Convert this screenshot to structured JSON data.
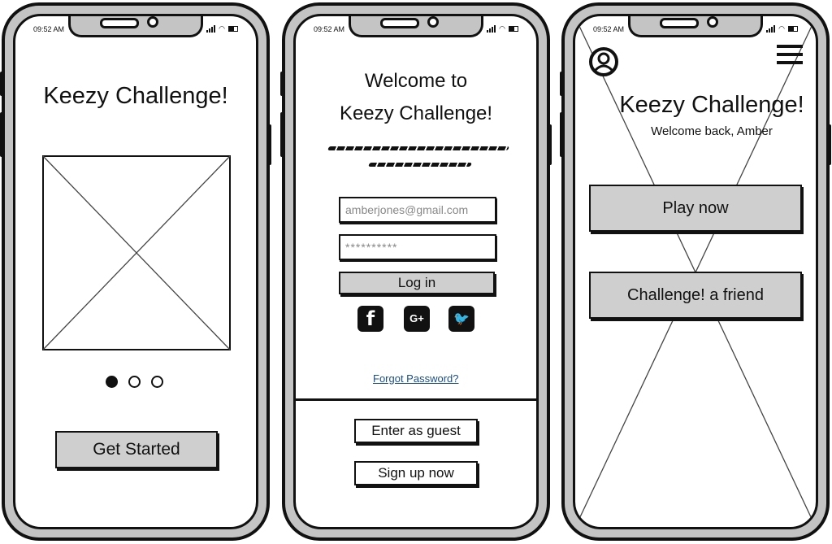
{
  "status_bar": {
    "time": "09:52 AM"
  },
  "screens": [
    {
      "name": "onboarding",
      "title": "Keezy Challenge!",
      "image_placeholder": "image-placeholder",
      "pager": {
        "count": 3,
        "active": 1
      },
      "primary_button": "Get Started"
    },
    {
      "name": "login",
      "title_line1": "Welcome to",
      "title_line2": "Keezy Challenge!",
      "email_value": "amberjones@gmail.com",
      "password_value": "**********",
      "login_button": "Log in",
      "social": [
        {
          "name": "facebook",
          "glyph": "f"
        },
        {
          "name": "google-plus",
          "glyph": "G+"
        },
        {
          "name": "twitter",
          "glyph": "🐦"
        }
      ],
      "forgot_link": "Forgot Password?",
      "guest_button": "Enter as guest",
      "signup_button": "Sign up now"
    },
    {
      "name": "home",
      "title": "Keezy Challenge!",
      "subtitle": "Welcome back, Amber",
      "play_button": "Play now",
      "challenge_button": "Challenge! a friend"
    }
  ],
  "colors": {
    "frame": "#c4c4c4",
    "button": "#cfcfcf",
    "link": "#1a4d8c",
    "stroke": "#111111"
  }
}
